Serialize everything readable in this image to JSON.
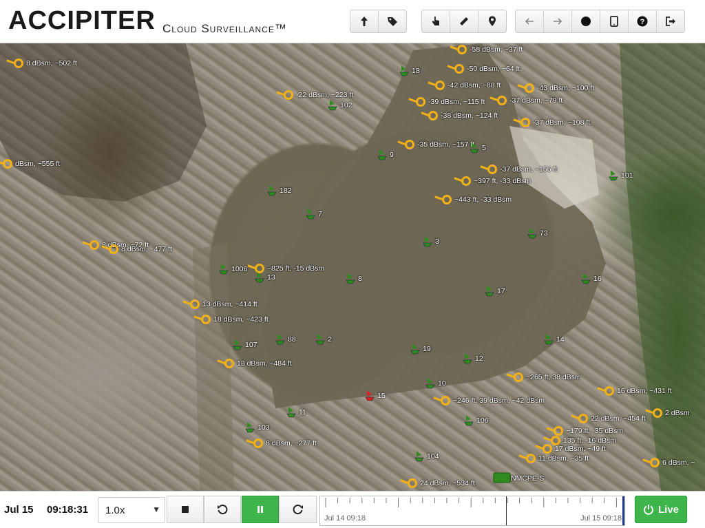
{
  "header": {
    "logo": "ACCIPITER",
    "tagline": "Cloud Surveillance™"
  },
  "toolbar": {
    "groups": [
      [
        {
          "icon": "arrow-up-icon"
        },
        {
          "icon": "tag-icon"
        }
      ],
      [
        {
          "icon": "pointer-hand-icon"
        },
        {
          "icon": "ruler-icon"
        },
        {
          "icon": "map-pin-icon"
        }
      ],
      [
        {
          "icon": "arrow-left-icon"
        },
        {
          "icon": "arrow-right-icon"
        },
        {
          "icon": "record-dot-icon"
        },
        {
          "icon": "tablet-icon"
        },
        {
          "icon": "help-icon"
        },
        {
          "icon": "logout-icon"
        }
      ]
    ]
  },
  "map": {
    "targets": [
      {
        "label": "8 dBsm, ~502 ft"
      },
      {
        "label": "-22 dBsm, ~223 ft"
      },
      {
        "label": "-50 dBsm, ~64 ft"
      },
      {
        "label": "-58 dBsm, ~37 ft"
      },
      {
        "label": "-42 dBsm, ~88 ft"
      },
      {
        "label": "-43 dBsm, ~100 ft"
      },
      {
        "label": "-39 dBsm, ~115 ft"
      },
      {
        "label": "-37 dBsm, ~79 ft"
      },
      {
        "label": "-38 dBsm, ~124 ft"
      },
      {
        "label": "-37 dBsm, ~108 ft"
      },
      {
        "label": "-35 dBsm, ~157 ft"
      },
      {
        "label": "-37 dBsm, ~156 ft"
      },
      {
        "label": "~397 ft, -33 dBsm"
      },
      {
        "label": "~443 ft, -33 dBsm"
      },
      {
        "label": "dBsm, ~555 ft"
      },
      {
        "label": "8 dBsm, ~72 ft"
      },
      {
        "label": "8 dBsm, ~477 ft"
      },
      {
        "label": "~825 ft, -15 dBsm"
      },
      {
        "label": "13 dBsm, ~414 ft"
      },
      {
        "label": "18 dBsm, ~423 ft"
      },
      {
        "label": "18 dBsm, ~484 ft"
      },
      {
        "label": "8 dBsm, ~277 ft"
      },
      {
        "label": "~265 ft, 38 dBsm"
      },
      {
        "label": "~246 ft, 39 dBsm, ~42 dBsm"
      },
      {
        "label": "16 dBsm, ~431 ft"
      },
      {
        "label": "22 dBsm, ~454 ft"
      },
      {
        "label": "2 dBsm"
      },
      {
        "label": "~179 ft, -35 dBsm"
      },
      {
        "label": "135 ft, -16 dBsm"
      },
      {
        "label": "17 dBsm, ~49 ft"
      },
      {
        "label": "11 dBsm, ~35 ft"
      },
      {
        "label": "6 dBsm, ~"
      },
      {
        "label": "24 dBsm, ~534 ft"
      }
    ],
    "sensors": [
      {
        "id": "18"
      },
      {
        "id": "102"
      },
      {
        "id": "9"
      },
      {
        "id": "5"
      },
      {
        "id": "182"
      },
      {
        "id": "101"
      },
      {
        "id": "7"
      },
      {
        "id": "3"
      },
      {
        "id": "73"
      },
      {
        "id": "1006"
      },
      {
        "id": "13"
      },
      {
        "id": "8"
      },
      {
        "id": "17"
      },
      {
        "id": "16"
      },
      {
        "id": "88"
      },
      {
        "id": "2"
      },
      {
        "id": "107"
      },
      {
        "id": "19"
      },
      {
        "id": "14"
      },
      {
        "id": "12"
      },
      {
        "id": "10"
      },
      {
        "id": "15"
      },
      {
        "id": "11"
      },
      {
        "id": "103"
      },
      {
        "id": "106"
      },
      {
        "id": "104"
      }
    ],
    "station_label": "NMCPE-S"
  },
  "footer": {
    "date": "Jul 15",
    "time": "09:18:31",
    "speed": "1.0x",
    "timeline_start": "Jul 14 09:18",
    "timeline_end": "Jul 15 09:18",
    "live_label": "Live"
  },
  "colors": {
    "target": "#f2b117",
    "sensor": "#2f8a1f",
    "alert": "#e02020",
    "live": "#3db54a"
  }
}
